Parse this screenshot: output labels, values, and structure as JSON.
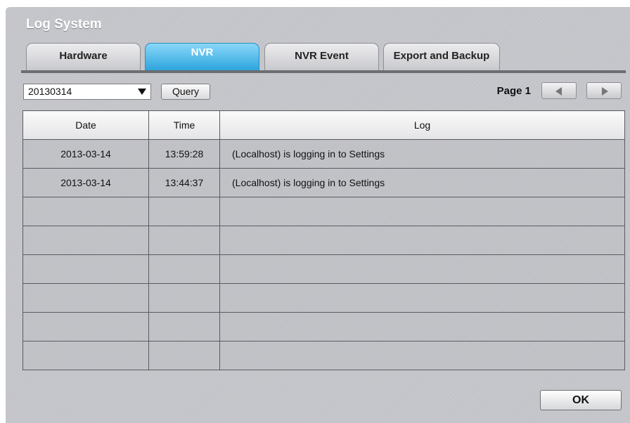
{
  "window": {
    "title": "Log System"
  },
  "tabs": [
    {
      "label": "Hardware",
      "active": false
    },
    {
      "label": "NVR",
      "active": true
    },
    {
      "label": "NVR Event",
      "active": false
    },
    {
      "label": "Export and Backup",
      "active": false
    }
  ],
  "controls": {
    "date_value": "20130314",
    "query_label": "Query",
    "page_label": "Page 1",
    "prev_icon": "triangle-left-icon",
    "next_icon": "triangle-right-icon"
  },
  "table": {
    "headers": {
      "date": "Date",
      "time": "Time",
      "log": "Log"
    },
    "rows": [
      {
        "date": "2013-03-14",
        "time": "13:59:28",
        "log": "(Localhost) is logging in to Settings"
      },
      {
        "date": "2013-03-14",
        "time": "13:44:37",
        "log": "(Localhost) is logging in to Settings"
      },
      {
        "date": "",
        "time": "",
        "log": ""
      },
      {
        "date": "",
        "time": "",
        "log": ""
      },
      {
        "date": "",
        "time": "",
        "log": ""
      },
      {
        "date": "",
        "time": "",
        "log": ""
      },
      {
        "date": "",
        "time": "",
        "log": ""
      },
      {
        "date": "",
        "time": "",
        "log": ""
      }
    ]
  },
  "footer": {
    "ok_label": "OK"
  },
  "colors": {
    "active_tab": "#2aa3dc",
    "panel_background": "#c3c4c9"
  }
}
